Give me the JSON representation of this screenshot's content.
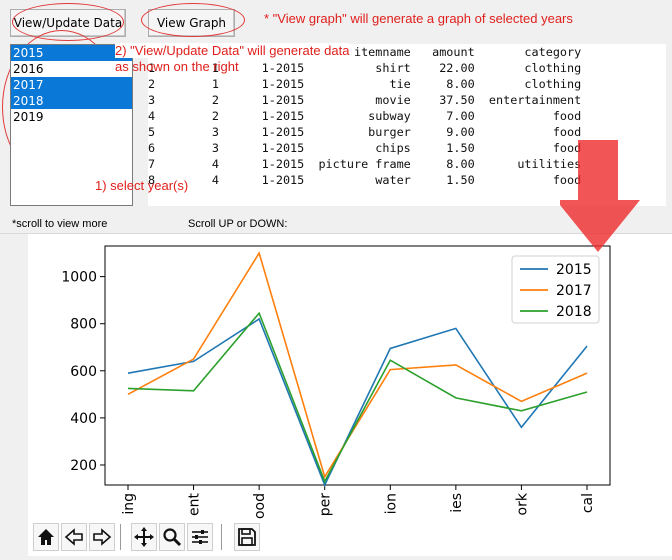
{
  "buttons": {
    "view_update": "View/Update Data",
    "view_graph": "View Graph"
  },
  "annotations": {
    "graph_note": "* \"View graph\" will generate a graph of selected years",
    "data_note_1": "2) \"View/Update Data\" will generate data",
    "data_note_2": "as shown on the right",
    "select_note": "1) select year(s)"
  },
  "years": [
    {
      "label": "2015",
      "selected": true
    },
    {
      "label": "2016",
      "selected": false
    },
    {
      "label": "2017",
      "selected": true
    },
    {
      "label": "2018",
      "selected": true
    },
    {
      "label": "2019",
      "selected": false
    }
  ],
  "table": {
    "headers": [
      "itemname",
      "amount",
      "category"
    ],
    "rows": [
      [
        "1",
        "1",
        "1-2015",
        "shirt",
        "22.00",
        "clothing"
      ],
      [
        "2",
        "1",
        "1-2015",
        "tie",
        "8.00",
        "clothing"
      ],
      [
        "3",
        "2",
        "1-2015",
        "movie",
        "37.50",
        "entertainment"
      ],
      [
        "4",
        "2",
        "1-2015",
        "subway",
        "7.00",
        "food"
      ],
      [
        "5",
        "3",
        "1-2015",
        "burger",
        "9.00",
        "food"
      ],
      [
        "6",
        "3",
        "1-2015",
        "chips",
        "1.50",
        "food"
      ],
      [
        "7",
        "4",
        "1-2015",
        "picture frame",
        "8.00",
        "utilities"
      ],
      [
        "8",
        "4",
        "1-2015",
        "water",
        "1.50",
        "food"
      ]
    ]
  },
  "hints": {
    "scroll_more": "*scroll to view more",
    "scroll_updown": "Scroll UP or DOWN:"
  },
  "chart_data": {
    "type": "line",
    "categories": [
      "ing",
      "ent",
      "ood",
      "per",
      "ion",
      "ies",
      "ork",
      "cal"
    ],
    "yticks": [
      200,
      400,
      600,
      800,
      1000
    ],
    "ylim": [
      115,
      1130
    ],
    "series": [
      {
        "name": "2015",
        "color": "#1f77b4",
        "values": [
          590,
          640,
          820,
          115,
          695,
          780,
          360,
          705
        ]
      },
      {
        "name": "2017",
        "color": "#ff7f0e",
        "values": [
          500,
          650,
          1100,
          150,
          605,
          625,
          470,
          590
        ]
      },
      {
        "name": "2018",
        "color": "#2ca02c",
        "values": [
          525,
          515,
          845,
          130,
          645,
          485,
          430,
          510
        ]
      }
    ],
    "legend": "top-right"
  },
  "toolbar_icons": [
    "home-icon",
    "back-icon",
    "forward-icon",
    "pan-icon",
    "zoom-icon",
    "configure-icon",
    "save-icon"
  ]
}
